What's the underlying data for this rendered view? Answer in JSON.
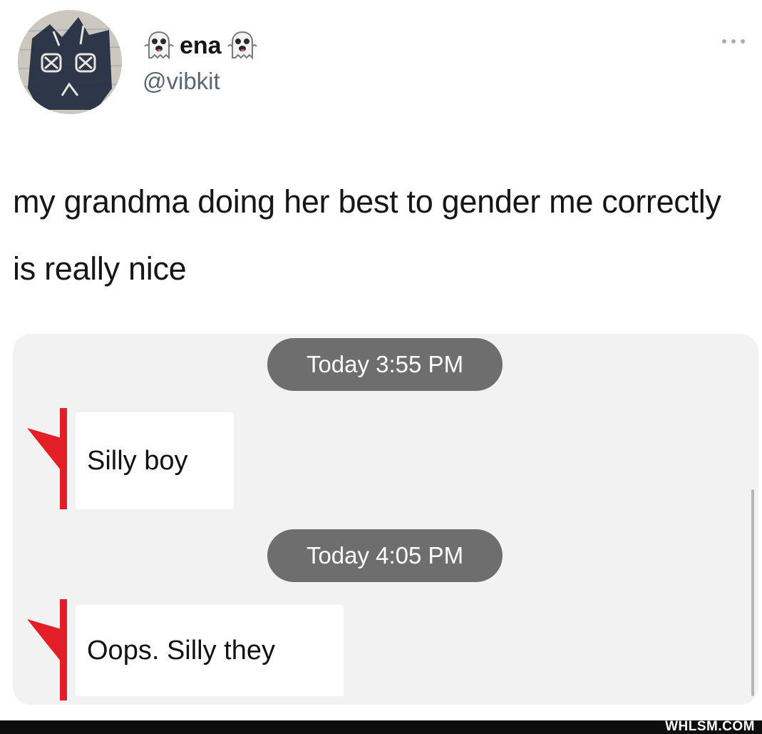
{
  "tweet": {
    "display_name": "ena",
    "handle": "@vibkit",
    "name_icon": "ghost-icon",
    "more_icon": "more-icon",
    "text": "my grandma doing her best to gender me correctly is really nice"
  },
  "embed": {
    "messages": [
      {
        "timestamp": "Today 3:55 PM",
        "text": "Silly boy"
      },
      {
        "timestamp": "Today 4:05 PM",
        "text": "Oops. Silly they"
      }
    ],
    "marker_color": "#e21e26",
    "pill_color": "#6e6e6e"
  },
  "watermark": {
    "text": "WHLSM.COM"
  }
}
